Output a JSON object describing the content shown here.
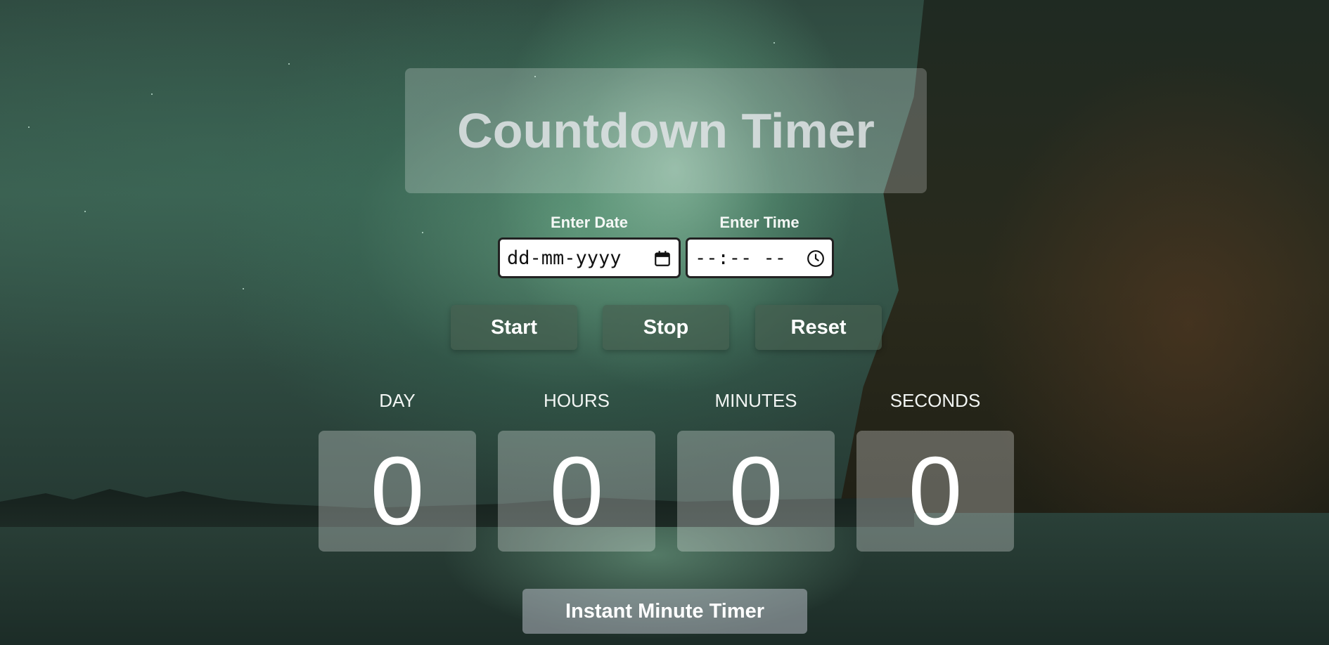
{
  "header": {
    "title": "Countdown Timer"
  },
  "inputs": {
    "date": {
      "label": "Enter Date",
      "value": "dd-mm-yyyy",
      "icon": "calendar-icon"
    },
    "time": {
      "label": "Enter Time",
      "value": "--:-- --",
      "icon": "clock-icon"
    }
  },
  "controls": {
    "start": "Start",
    "stop": "Stop",
    "reset": "Reset"
  },
  "countdown": {
    "units": [
      {
        "label": "DAY",
        "value": "0"
      },
      {
        "label": "HOURS",
        "value": "0"
      },
      {
        "label": "MINUTES",
        "value": "0"
      },
      {
        "label": "SECONDS",
        "value": "0"
      }
    ]
  },
  "instant": {
    "label": "Instant Minute Timer"
  }
}
